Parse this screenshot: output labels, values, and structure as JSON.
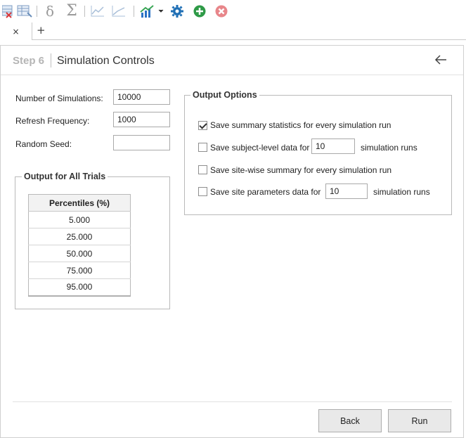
{
  "toolbar": {
    "icons": [
      "delete-table-icon",
      "table-grid-icon",
      "delta-icon",
      "sigma-icon",
      "line-chart-icon",
      "line-chart-2-icon",
      "bar-chart-icon",
      "dropdown-arrow-icon",
      "settings-gear-icon",
      "add-icon",
      "remove-icon"
    ],
    "delta_glyph": "δ",
    "sigma_glyph": "Σ",
    "colors": {
      "gear": "#1f6fb5",
      "add": "#2e9a47",
      "remove": "#e8868a",
      "chart": "#2a72c4"
    }
  },
  "tabs": {
    "close_glyph": "×",
    "add_glyph": "+"
  },
  "header": {
    "step": "Step 6",
    "title": "Simulation Controls"
  },
  "fields": {
    "num_sims_label": "Number of Simulations:",
    "num_sims_value": "10000",
    "refresh_label": "Refresh Frequency:",
    "refresh_value": "1000",
    "seed_label": "Random Seed:",
    "seed_value": ""
  },
  "output_all_trials": {
    "title": "Output for All Trials",
    "column_header": "Percentiles (%)",
    "rows": [
      "5.000",
      "25.000",
      "50.000",
      "75.000",
      "95.000"
    ]
  },
  "output_options": {
    "title": "Output Options",
    "opt1": {
      "label": "Save summary statistics for every simulation run",
      "checked": true
    },
    "opt2": {
      "label": "Save subject-level data for",
      "value": "10",
      "suffix": "simulation runs",
      "checked": false
    },
    "opt3": {
      "label": "Save site-wise summary for every simulation run",
      "checked": false
    },
    "opt4": {
      "label": "Save site parameters data for",
      "value": "10",
      "suffix": "simulation runs",
      "checked": false
    }
  },
  "buttons": {
    "back": "Back",
    "run": "Run"
  }
}
